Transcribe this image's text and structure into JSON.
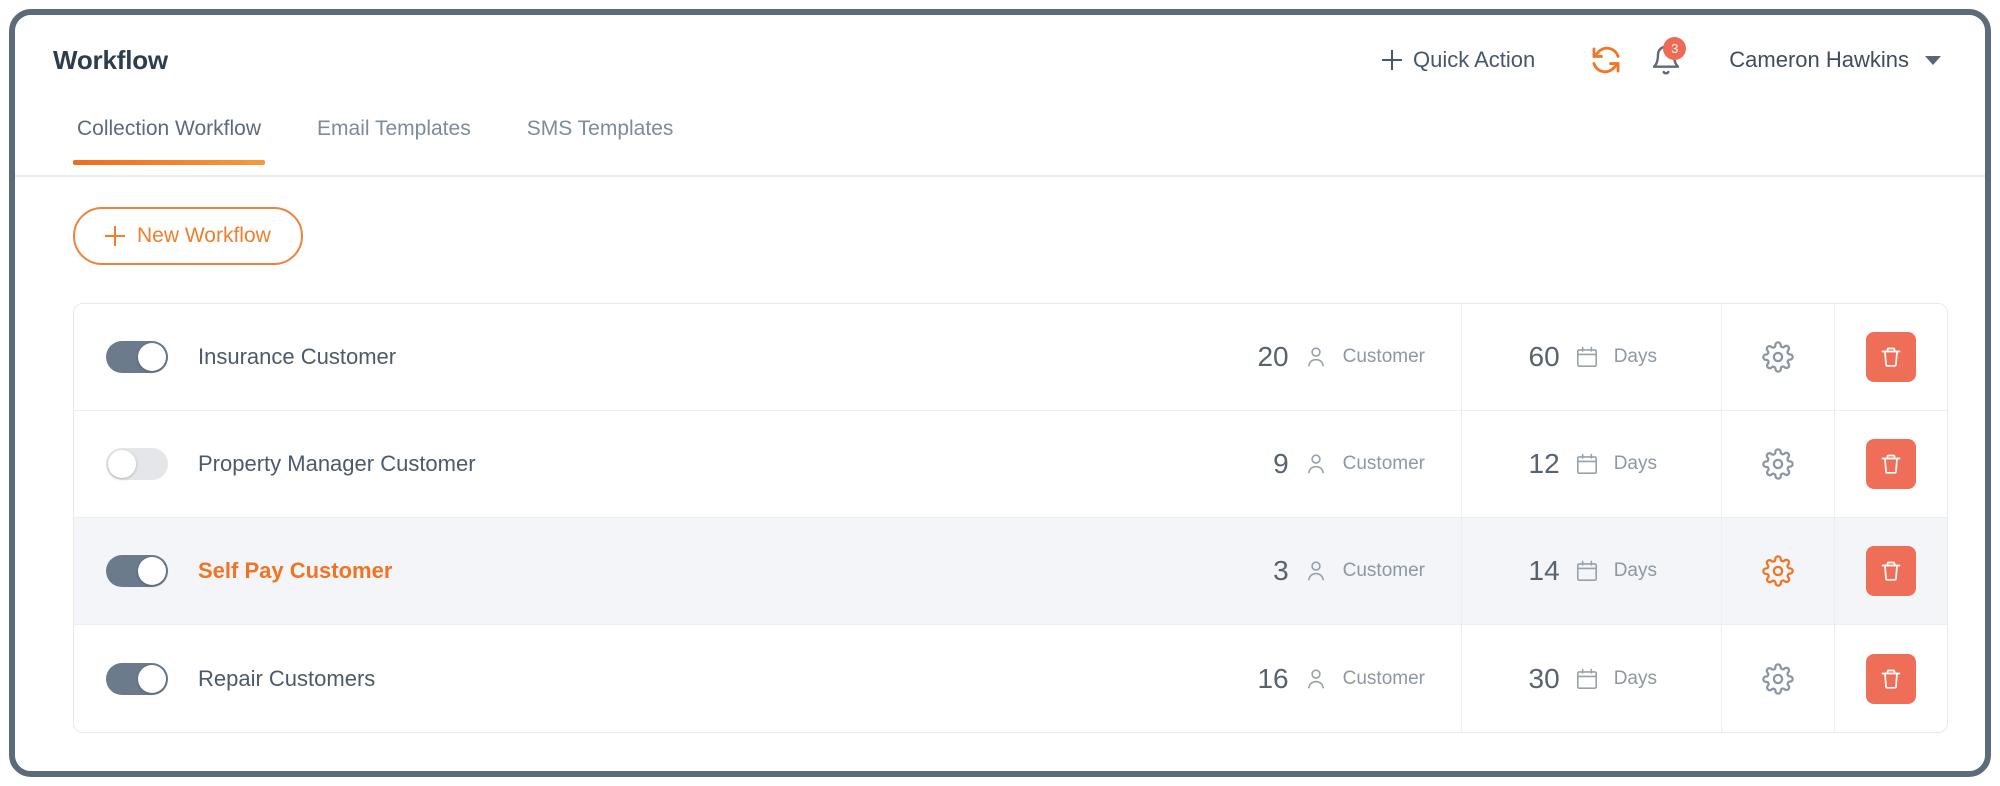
{
  "header": {
    "title": "Workflow",
    "quick_action_label": "Quick Action",
    "plus_icon": "plus-icon",
    "refresh_icon": "refresh-icon",
    "bell_icon": "bell-icon",
    "notification_count": "3",
    "user_name": "Cameron Hawkins",
    "caret_icon": "chevron-down-icon"
  },
  "tabs": [
    {
      "label": "Collection Workflow",
      "active": true
    },
    {
      "label": "Email Templates",
      "active": false
    },
    {
      "label": "SMS Templates",
      "active": false
    }
  ],
  "toolbar": {
    "new_workflow_label": "New Workflow"
  },
  "table": {
    "customer_label": "Customer",
    "days_label": "Days",
    "gear_icon": "gear-icon",
    "delete_icon": "trash-icon",
    "person_icon": "person-icon",
    "calendar_icon": "calendar-icon",
    "rows": [
      {
        "name": "Insurance Customer",
        "enabled": true,
        "selected": false,
        "customers": "20",
        "days": "60"
      },
      {
        "name": "Property Manager Customer",
        "enabled": false,
        "selected": false,
        "customers": "9",
        "days": "12"
      },
      {
        "name": "Self Pay Customer",
        "enabled": true,
        "selected": true,
        "customers": "3",
        "days": "14"
      },
      {
        "name": "Repair Customers",
        "enabled": true,
        "selected": false,
        "customers": "16",
        "days": "30"
      }
    ]
  },
  "colors": {
    "accent_orange": "#ef7423",
    "danger_red": "#ef6e58",
    "toggle_on": "#6b7b8c",
    "frame_border": "#5c6b7a",
    "selected_row": "#f3f5f8"
  }
}
